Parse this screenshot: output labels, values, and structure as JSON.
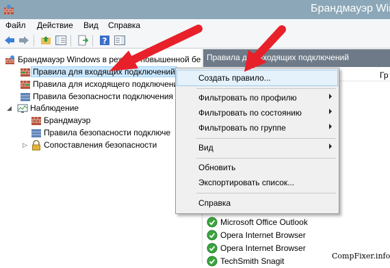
{
  "window": {
    "title": "Брандмауэр Windo"
  },
  "menubar": {
    "items": [
      "Файл",
      "Действие",
      "Вид",
      "Справка"
    ]
  },
  "toolbar": {
    "icons": [
      "back-icon",
      "forward-icon",
      "up-folder-icon",
      "show-tree-icon",
      "export-icon",
      "help-icon",
      "properties-icon"
    ]
  },
  "tree": {
    "root": "Брандмауэр Windows в режиме повышенной бе",
    "items": [
      "Правила для входящих подключений",
      "Правила для исходящего подключения",
      "Правила безопасности подключения",
      "Наблюдение",
      "Брандмауэр",
      "Правила безопасности подключе",
      "Сопоставления безопасности"
    ]
  },
  "right_pane": {
    "header": "Правила для входящих подключений",
    "column_group": "Гр",
    "items": [
      "Microsoft Office Outlook",
      "Opera Internet Browser",
      "Opera Internet Browser",
      "TechSmith Snagit"
    ]
  },
  "context_menu": {
    "items": [
      {
        "label": "Создать правило...",
        "submenu": false
      },
      {
        "label": "Фильтровать по профилю",
        "submenu": true
      },
      {
        "label": "Фильтровать по состоянию",
        "submenu": true
      },
      {
        "label": "Фильтровать по группе",
        "submenu": true
      },
      {
        "label": "Вид",
        "submenu": true
      },
      {
        "label": "Обновить",
        "submenu": false
      },
      {
        "label": "Экспортировать список...",
        "submenu": false
      },
      {
        "label": "Справка",
        "submenu": false
      }
    ]
  },
  "watermark": "CompFixer.info",
  "colors": {
    "titlebar": "#8ba7b8",
    "pane_header": "#6e7a88",
    "annotation_arrow": "#e8202a",
    "selection": "#cce8ff"
  }
}
